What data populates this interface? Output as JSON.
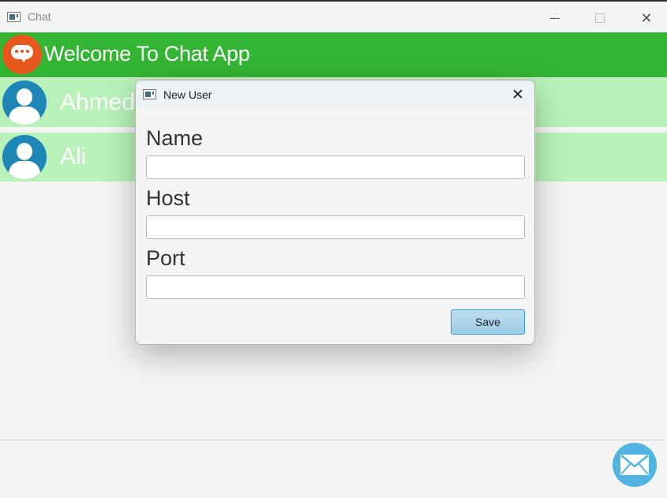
{
  "window": {
    "title": "Chat"
  },
  "header": {
    "welcome": "Welcome To Chat App"
  },
  "users": [
    {
      "name": "Ahmed"
    },
    {
      "name": "Ali"
    }
  ],
  "dialog": {
    "title": "New User",
    "fields": {
      "name_label": "Name",
      "name_value": "",
      "host_label": "Host",
      "host_value": "",
      "port_label": "Port",
      "port_value": ""
    },
    "save_label": "Save"
  },
  "colors": {
    "header_green": "#33b533",
    "row_green": "#b9f2b9",
    "logo_orange": "#e8571b",
    "avatar_blue": "#1e86b7",
    "fab_blue": "#4fb4e0"
  },
  "icons": {
    "logo": "chat-bubble-icon",
    "avatar": "user-avatar-icon",
    "fab": "envelope-icon"
  }
}
